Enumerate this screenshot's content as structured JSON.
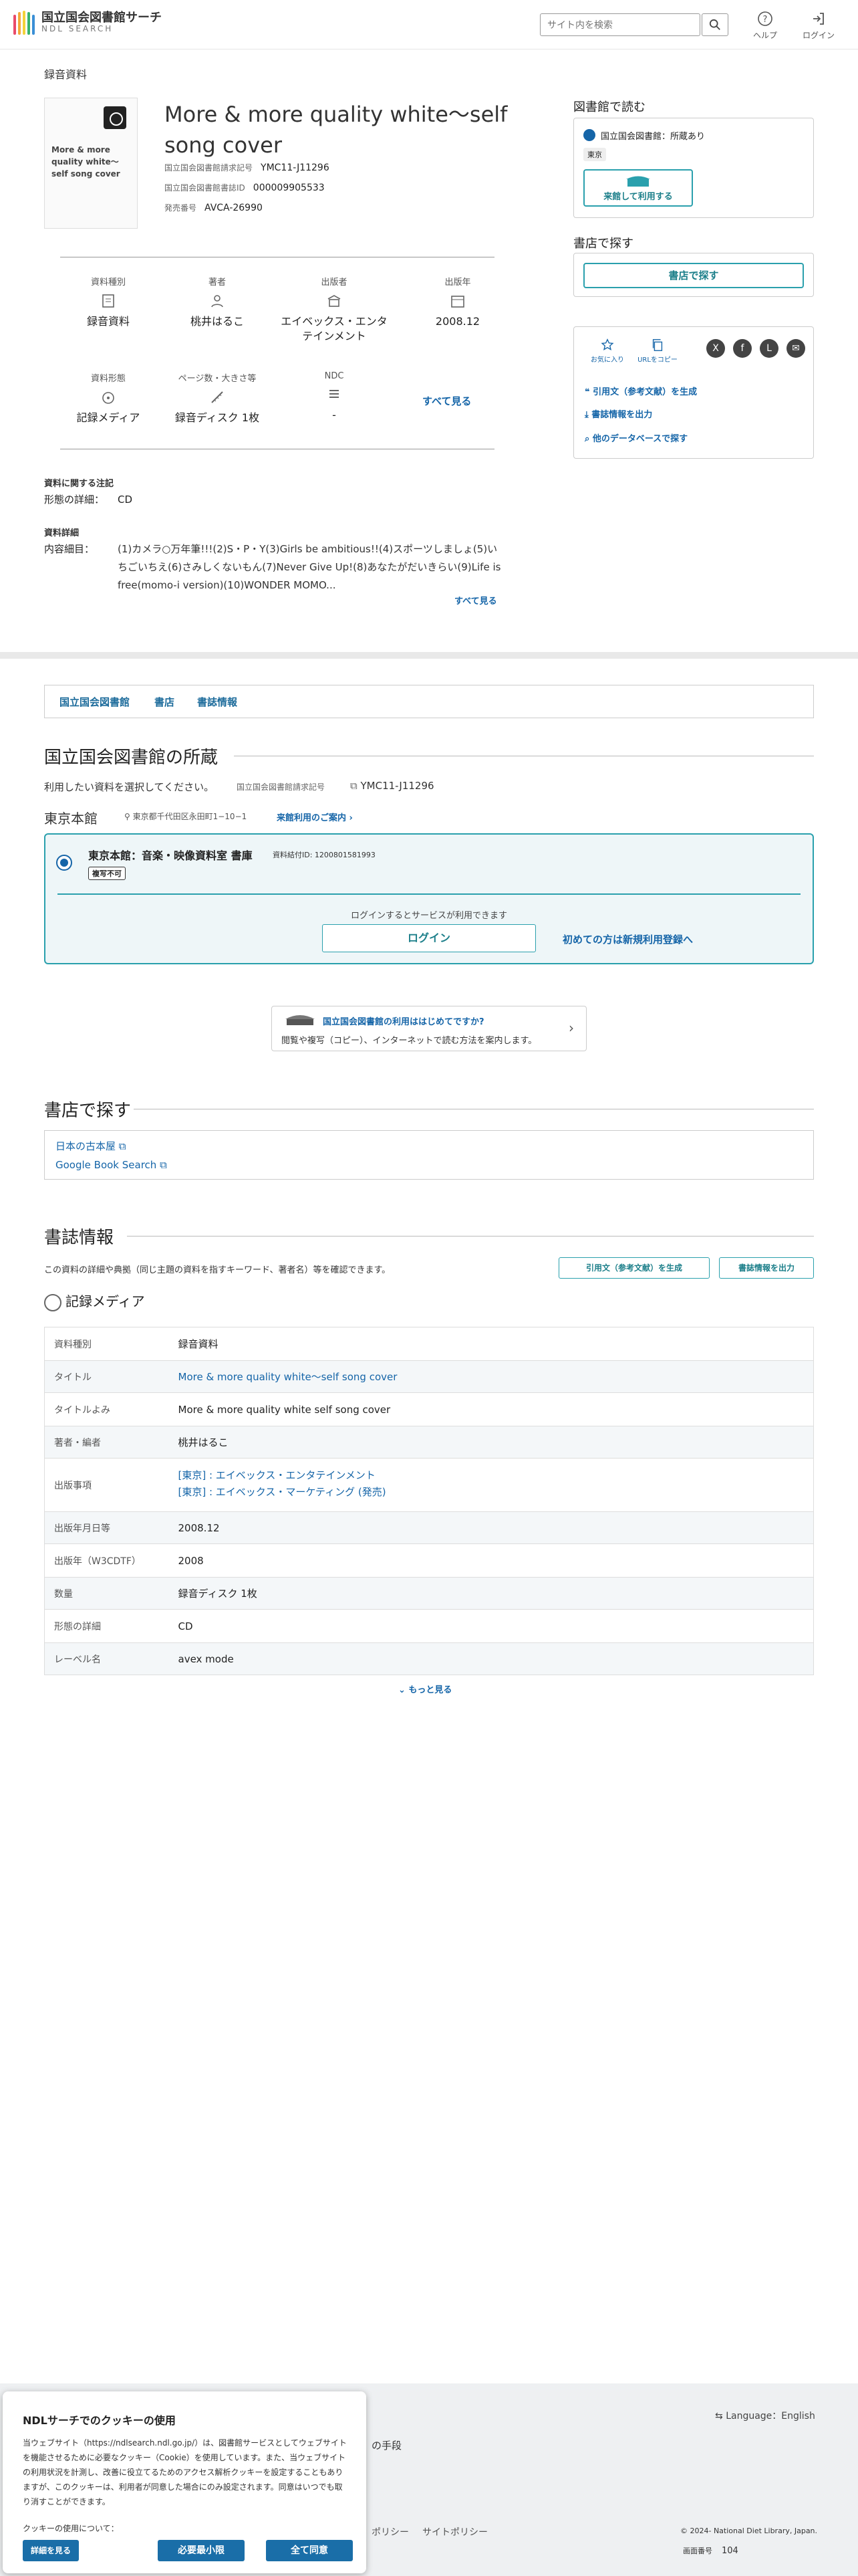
{
  "header": {
    "logo_title": "国立国会図書館サーチ",
    "logo_sub": "NDL SEARCH",
    "search_placeholder": "サイト内を検索",
    "help_label": "ヘルプ",
    "login_label": "ログイン"
  },
  "item": {
    "section_label": "録音資料",
    "thumb_title": "More & more quality white〜self song cover",
    "title": "More & more quality white〜self song cover",
    "meta": [
      {
        "key": "国立国会図書館請求記号",
        "value": "YMC11-J11296"
      },
      {
        "key": "国立国会図書館書誌ID",
        "value": "000009905533"
      },
      {
        "key": "発売番号",
        "value": "AVCA-26990"
      }
    ],
    "facets": [
      {
        "label": "資料種別",
        "value": "録音資料",
        "icon": "file-icon"
      },
      {
        "label": "著者",
        "value": "桃井はるこ",
        "icon": "person-icon"
      },
      {
        "label": "出版者",
        "value": "エイベックス・エンタテインメント",
        "icon": "building-icon"
      },
      {
        "label": "出版年",
        "value": "2008.12",
        "icon": "calendar-icon"
      },
      {
        "label": "資料形態",
        "value": "記録メディア",
        "icon": "disc-icon"
      },
      {
        "label": "ページ数・大きさ等",
        "value": "録音ディスク 1枚",
        "icon": "ruler-icon"
      },
      {
        "label": "NDC",
        "value": "-",
        "icon": "ndc-icon"
      }
    ],
    "facets_more": "すべて見る",
    "notes_heading": "資料に関する注記",
    "form_detail_key": "形態の詳細：",
    "form_detail_value": "CD",
    "detail_heading": "資料詳細",
    "contents_key": "内容細目：",
    "contents_value": "(1)カメラ○万年筆!!!(2)S・P・Y(3)Girls be ambitious!!(4)スポーツしましょ(5)いちごいちえ(6)さみしくないもん(7)Never Give Up!(8)あなたがだいきらい(9)Life is free(momo-i version)(10)WONDER MOMO...",
    "contents_more": "すべて見る"
  },
  "right": {
    "read_heading": "図書館で読む",
    "library_status": "国立国会図書館：所蔵あり",
    "location_tag": "東京",
    "visit_button": "来館して利用する",
    "bookstore_heading": "書店で探す",
    "bookstore_button": "書店で探す",
    "favorite_label": "お気に入り",
    "copy_url_label": "URLをコピー",
    "cite_link": "引用文（参考文献）を生成",
    "export_link": "書誌情報を出力",
    "other_db_link": "他のデータベースで探す"
  },
  "tabs": [
    "国立国会図書館",
    "書店",
    "書誌情報"
  ],
  "holdings": {
    "heading": "国立国会図書館の所蔵",
    "instruction": "利用したい資料を選択してください。",
    "call_no_key": "国立国会図書館請求記号",
    "call_no_value": "YMC11-J11296",
    "branch": "東京本館",
    "address": "東京都千代田区永田町1−10−1",
    "guide_link": "来館利用のご案内",
    "room": "東京本館：音楽・映像資料室 書庫",
    "item_id": "資料結付ID: 1200801581993",
    "copy_badge": "複写不可",
    "login_prompt": "ログインするとサービスが利用できます",
    "login_button": "ログイン",
    "register_link": "初めての方は新規利用登録へ",
    "guide_title": "国立国会図書館の利用ははじめてですか?",
    "guide_desc": "閲覧や複写（コピー）、インターネットで読む方法を案内します。"
  },
  "bookstores": {
    "heading": "書店で探す",
    "links": [
      "日本の古本屋",
      "Google Book Search"
    ]
  },
  "biblio": {
    "heading": "書誌情報",
    "desc": "この資料の詳細や典拠（同じ主題の資料を指すキーワード、著者名）等を確認できます。",
    "cite_button": "引用文（参考文献）を生成",
    "export_button": "書誌情報を出力",
    "media_heading": "記録メディア",
    "rows": [
      {
        "key": "資料種別",
        "value": "録音資料"
      },
      {
        "key": "タイトル",
        "value": "More & more quality white〜self song cover"
      },
      {
        "key": "タイトルよみ",
        "value": "More & more quality white self song cover"
      },
      {
        "key": "著者・編者",
        "value": "桃井はるこ"
      },
      {
        "key": "出版事項",
        "value": "[東京] : エイベックス・エンタテインメント",
        "value2": "[東京] : エイベックス・マーケティング (発売)"
      },
      {
        "key": "出版年月日等",
        "value": "2008.12"
      },
      {
        "key": "出版年（W3CDTF）",
        "value": "2008"
      },
      {
        "key": "数量",
        "value": "録音ディスク 1枚"
      },
      {
        "key": "形態の詳細",
        "value": "CD"
      },
      {
        "key": "レーベル名",
        "value": "avex mode"
      }
    ],
    "more": "もっと見る"
  },
  "footer": {
    "language": "Language：English",
    "partial_text": "の手段",
    "policy1": "ポリシー",
    "policy2": "サイトポリシー",
    "copyright": "© 2024- National Diet Library, Japan.",
    "screen_no_key": "画面番号",
    "screen_no": "104"
  },
  "cookie": {
    "title": "NDLサーチでのクッキーの使用",
    "body": "当ウェブサイト（https://ndlsearch.ndl.go.jp/）は、図書館サービスとしてウェブサイトを機能させるために必要なクッキー（Cookie）を使用しています。また、当ウェブサイトの利用状況を計測し、改善に役立てるためのアクセス解析クッキーを設定することもありますが、このクッキーは、利用者が同意した場合にのみ設定されます。同意はいつでも取り消すことができます。",
    "usage_label": "クッキーの使用について：",
    "details_link": "詳細を見る",
    "minimal_button": "必要最小限",
    "accept_button": "全て同意"
  },
  "colors": {
    "accent": "#2aa0ad",
    "link": "#1565a8",
    "primary_button": "#1a6ea8"
  }
}
